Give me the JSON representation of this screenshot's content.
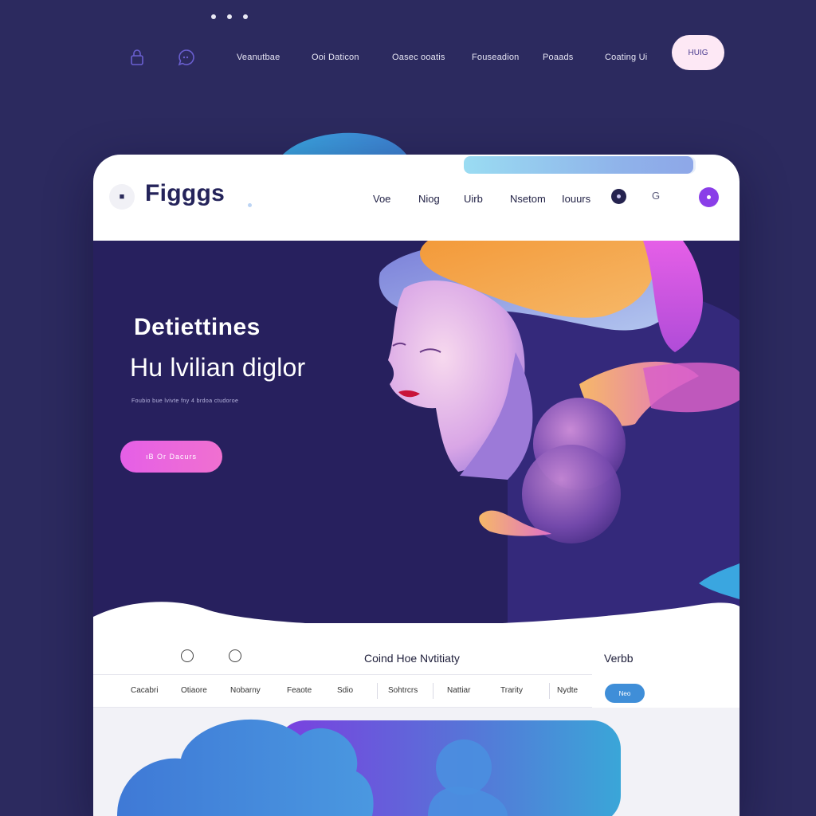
{
  "outer_nav": {
    "links": [
      "Veanutbae",
      "Ooi Daticon",
      "Oasec ooatis",
      "Fouseadion",
      "Poaads",
      "Coating Ui"
    ],
    "cta": "HUIG",
    "icons": [
      "lock-icon",
      "chat-icon"
    ]
  },
  "app": {
    "brand": "Figggs",
    "logo_glyph": "■",
    "nav": [
      "Voe",
      "Niog",
      "Uirb",
      "Nsetom",
      "Iouurs"
    ],
    "g_icon_glyph": "G",
    "progress": 0.99
  },
  "hero": {
    "title_line1": "Detiettines",
    "title_line2": "Hu lvilian diglor",
    "subtitle": "Foubio bue lvivte fny 4 brdoa ctudoroe",
    "cta": "ıB Or Dacurs"
  },
  "subnav": {
    "title": "Coind Hoe Nvtitiaty",
    "right_label": "Verbb",
    "filters": [
      "Cacabri",
      "Otiaore",
      "Nobarny",
      "Feaote",
      "Sdio",
      "Sohtrcrs",
      "Nattiar",
      "Trarity",
      "Nydte"
    ],
    "button": "Neo"
  },
  "colors": {
    "page_bg": "#2c2a5f",
    "hero_bg": "#27205e",
    "accent_pink": "#e55fe7",
    "accent_purple": "#8a3ee8",
    "accent_blue": "#3f8ed8"
  }
}
